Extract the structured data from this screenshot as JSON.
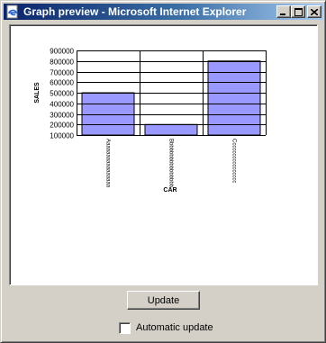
{
  "window": {
    "title": "Graph preview - Microsoft Internet Explorer",
    "icon": "ie-page-icon"
  },
  "controls": {
    "update_label": "Update",
    "auto_update_label": "Automatic update",
    "auto_update_checked": false
  },
  "chart_data": {
    "type": "bar",
    "categories": [
      "Aaaaaaaaaaaaaaaa",
      "Bbbbbbbbbbbbbbbb",
      "Cccccccccccccccc"
    ],
    "values": [
      500000,
      200000,
      800000
    ],
    "xlabel": "CAR",
    "ylabel": "SALES",
    "yticks": [
      "900000",
      "800000",
      "700000",
      "600000",
      "500000",
      "400000",
      "300000",
      "200000",
      "100000"
    ],
    "ylim": [
      100000,
      900000
    ],
    "grid": true,
    "bar_color": "#9999ff"
  }
}
